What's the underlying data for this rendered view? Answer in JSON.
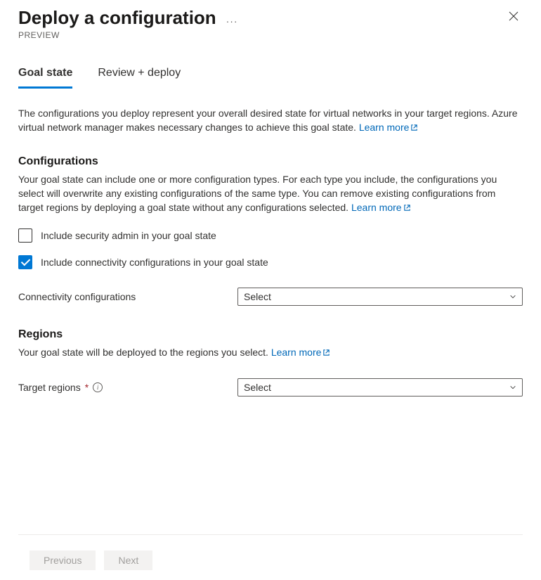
{
  "header": {
    "title": "Deploy a configuration",
    "subtitle": "PREVIEW"
  },
  "tabs": [
    {
      "id": "goal-state",
      "label": "Goal state",
      "active": true
    },
    {
      "id": "review-deploy",
      "label": "Review + deploy",
      "active": false
    }
  ],
  "intro": {
    "text": "The configurations you deploy represent your overall desired state for virtual networks in your target regions. Azure virtual network manager makes necessary changes to achieve this goal state.",
    "learn_more": "Learn more"
  },
  "configurations": {
    "heading": "Configurations",
    "desc": "Your goal state can include one or more configuration types. For each type you include, the configurations you select will overwrite any existing configurations of the same type. You can remove existing configurations from target regions by deploying a goal state without any configurations selected.",
    "learn_more": "Learn more",
    "checkboxes": {
      "security": {
        "label": "Include security admin in your goal state",
        "checked": false
      },
      "connectivity": {
        "label": "Include connectivity configurations in your goal state",
        "checked": true
      }
    },
    "conn_field_label": "Connectivity configurations",
    "conn_field_value": "Select"
  },
  "regions": {
    "heading": "Regions",
    "desc": "Your goal state will be deployed to the regions you select.",
    "learn_more": "Learn more",
    "target_label": "Target regions",
    "target_value": "Select"
  },
  "footer": {
    "previous": "Previous",
    "next": "Next"
  }
}
